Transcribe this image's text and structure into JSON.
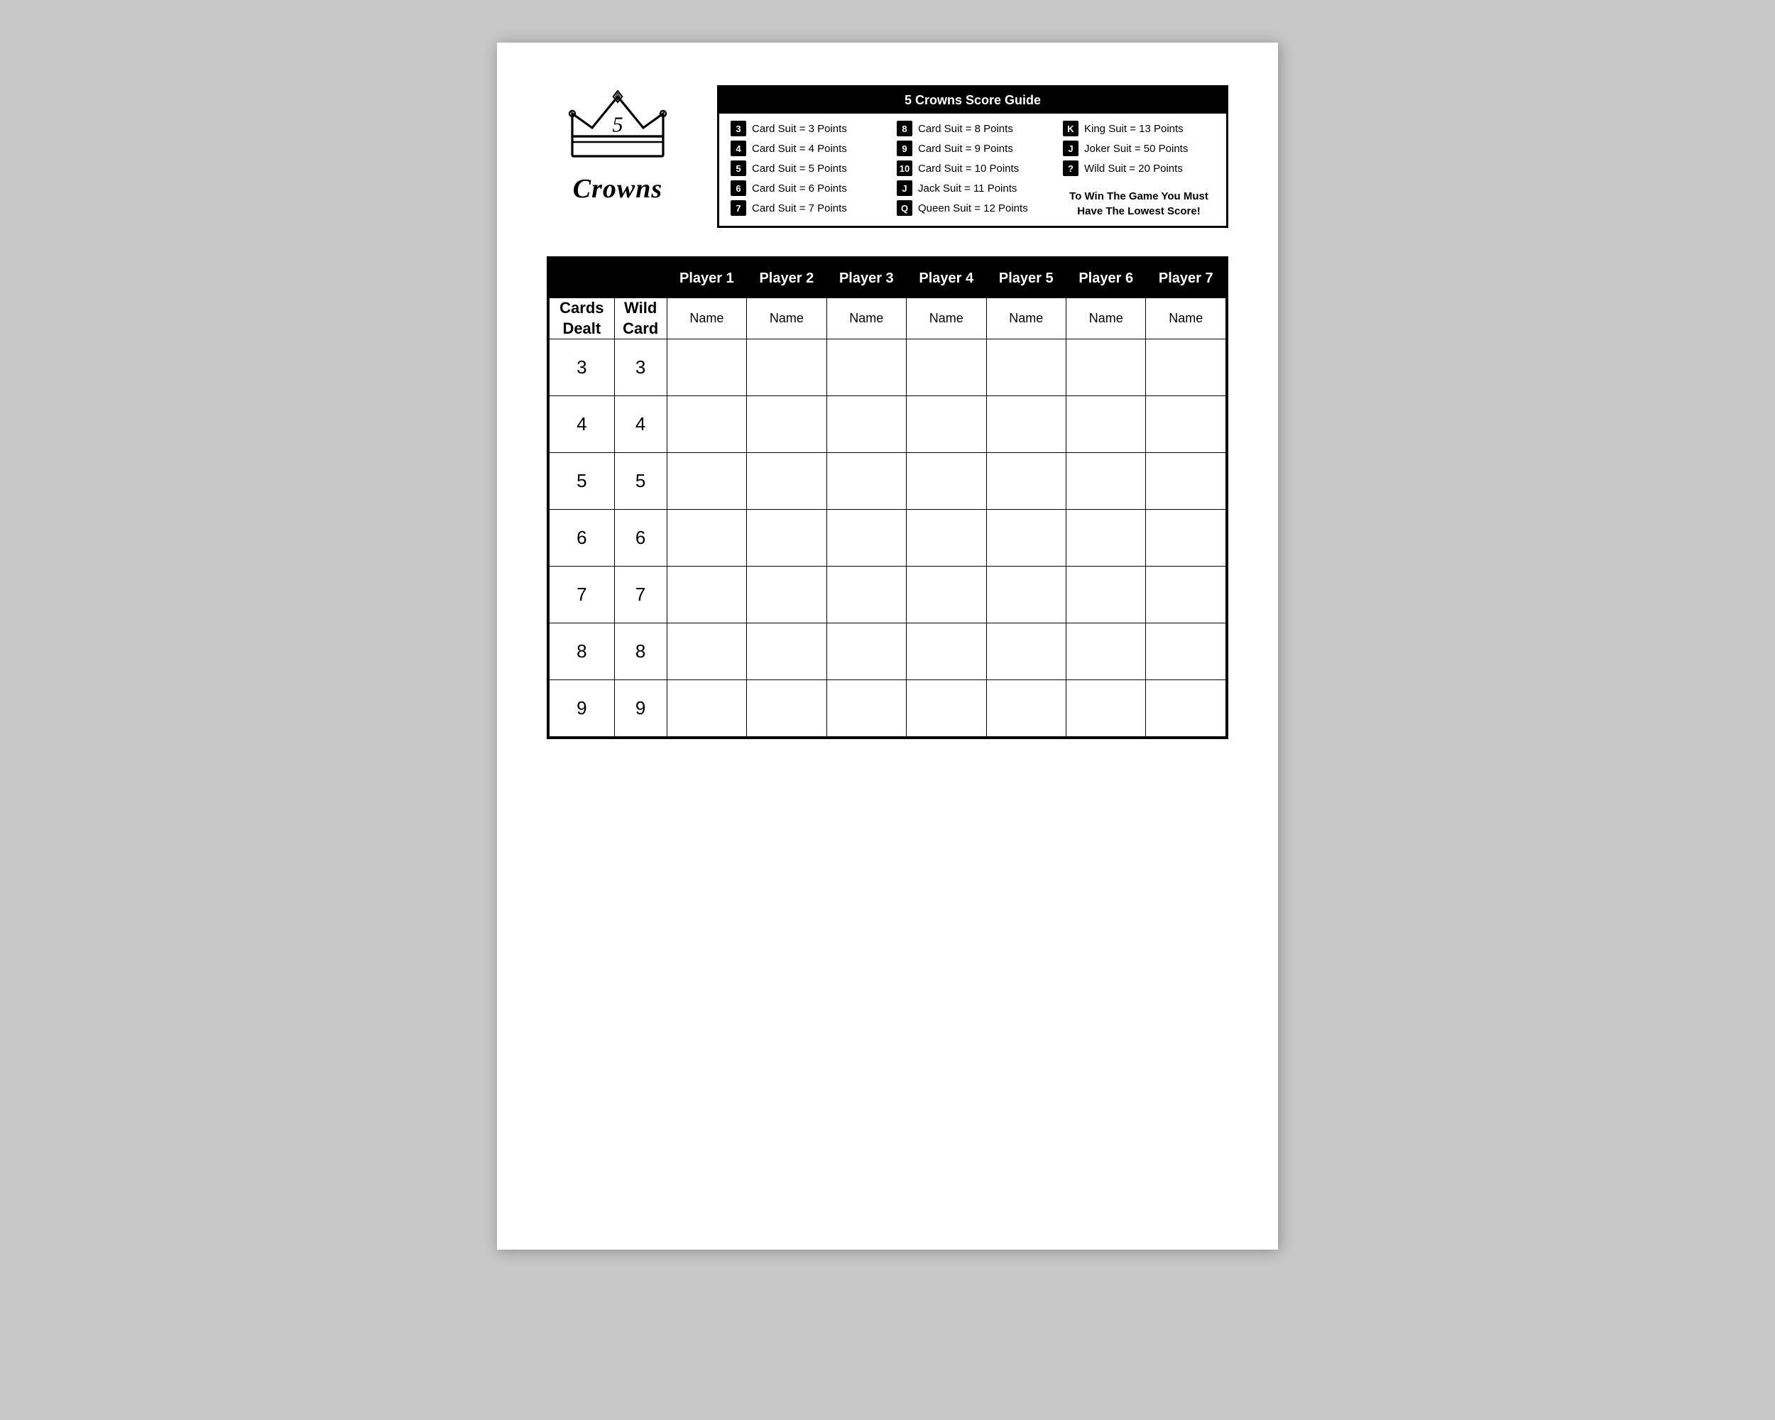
{
  "logo": {
    "title": "Crowns"
  },
  "scoreGuide": {
    "title": "5 Crowns Score Guide",
    "col1": [
      {
        "badge": "3",
        "text": "Card Suit = 3 Points"
      },
      {
        "badge": "4",
        "text": "Card Suit = 4 Points"
      },
      {
        "badge": "5",
        "text": "Card Suit = 5 Points"
      },
      {
        "badge": "6",
        "text": "Card Suit = 6 Points"
      },
      {
        "badge": "7",
        "text": "Card Suit = 7 Points"
      }
    ],
    "col2": [
      {
        "badge": "8",
        "text": "Card Suit = 8 Points"
      },
      {
        "badge": "9",
        "text": "Card Suit = 9 Points"
      },
      {
        "badge": "10",
        "text": "Card Suit = 10 Points"
      },
      {
        "badge": "J",
        "text": "Jack Suit = 11 Points"
      },
      {
        "badge": "Q",
        "text": "Queen Suit = 12 Points"
      }
    ],
    "col3": [
      {
        "badge": "K",
        "text": "King Suit = 13 Points"
      },
      {
        "badge": "J",
        "text": "Joker Suit = 50 Points"
      },
      {
        "badge": "?",
        "text": "Wild Suit = 20 Points"
      }
    ],
    "winText": "To Win The Game You Must Have The Lowest Score!"
  },
  "table": {
    "players": [
      "Player 1",
      "Player 2",
      "Player 3",
      "Player 4",
      "Player 5",
      "Player 6",
      "Player 7"
    ],
    "nameLabel": "Name",
    "cardsDealtLabel": "Cards\nDealt",
    "wildCardLabel": "Wild\nCard",
    "rounds": [
      {
        "cards": "3",
        "wild": "3"
      },
      {
        "cards": "4",
        "wild": "4"
      },
      {
        "cards": "5",
        "wild": "5"
      },
      {
        "cards": "6",
        "wild": "6"
      },
      {
        "cards": "7",
        "wild": "7"
      },
      {
        "cards": "8",
        "wild": "8"
      },
      {
        "cards": "9",
        "wild": "9"
      }
    ]
  }
}
